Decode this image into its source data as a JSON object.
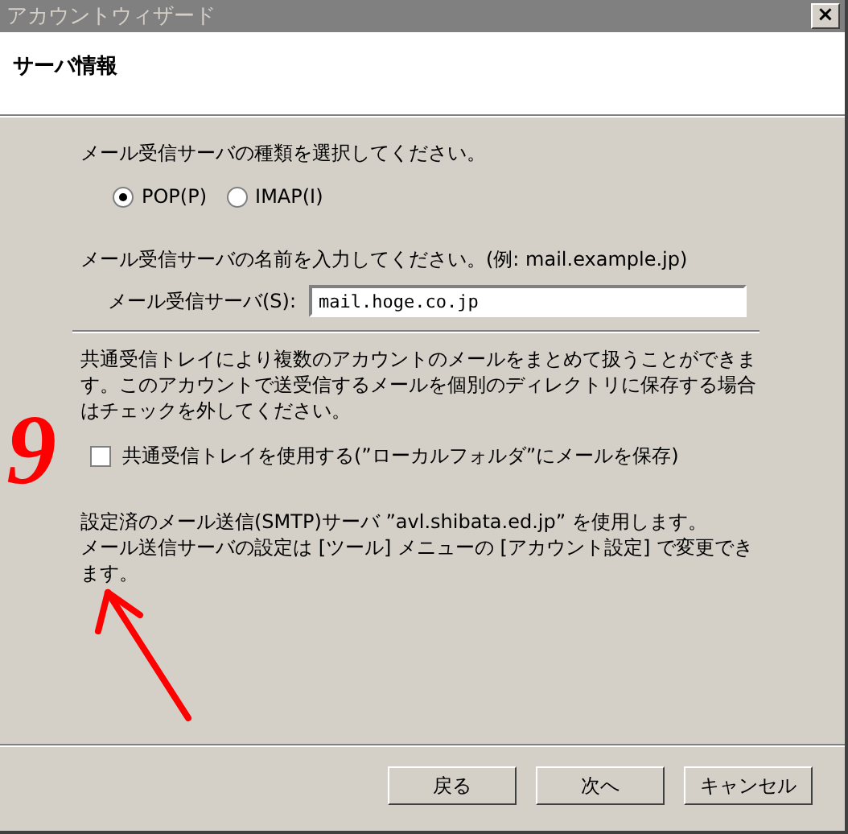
{
  "window": {
    "title": "アカウントウィザード",
    "close": "×"
  },
  "header": {
    "title": "サーバ情報"
  },
  "server_type": {
    "prompt": "メール受信サーバの種類を選択してください。",
    "options": [
      {
        "label": "POP(P)",
        "selected": true
      },
      {
        "label": "IMAP(I)",
        "selected": false
      }
    ]
  },
  "server_name": {
    "prompt": "メール受信サーバの名前を入力してください。(例: mail.example.jp)",
    "label": "メール受信サーバ(S):",
    "value": "mail.hoge.co.jp"
  },
  "shared_inbox": {
    "description": "共通受信トレイにより複数のアカウントのメールをまとめて扱うことができます。このアカウントで送受信するメールを個別のディレクトリに保存する場合はチェックを外してください。",
    "checkbox": {
      "label": "共通受信トレイを使用する(”ローカルフォルダ”にメールを保存)",
      "checked": false
    }
  },
  "smtp_note": {
    "lines": [
      "設定済のメール送信(SMTP)サーバ ”avl.shibata.ed.jp” を使用します。",
      "メール送信サーバの設定は [ツール] メニューの [アカウント設定] で変更できます。"
    ]
  },
  "annotation": {
    "label": "9"
  },
  "buttons": [
    "戻る",
    "次へ",
    "キャンセル"
  ]
}
